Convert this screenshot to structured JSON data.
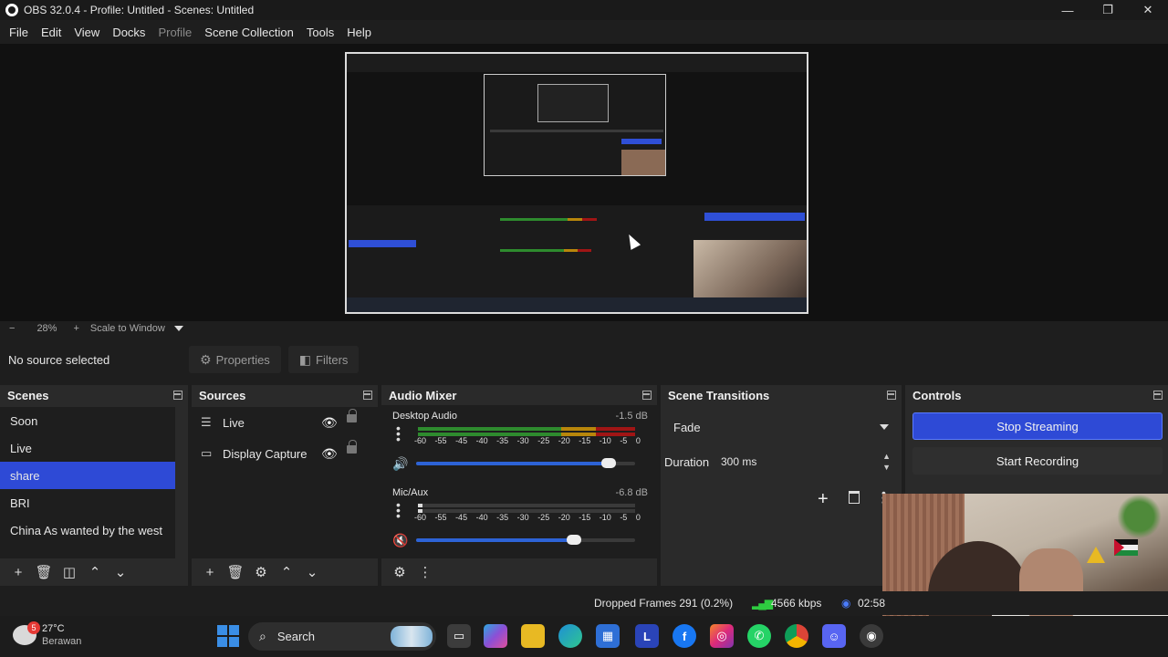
{
  "window": {
    "title": "OBS 32.0.4 - Profile: Untitled - Scenes: Untitled",
    "controls": {
      "minimize": "—",
      "restore": "❐",
      "close": "✕"
    }
  },
  "menu": {
    "file": "File",
    "edit": "Edit",
    "view": "View",
    "docks": "Docks",
    "profile": "Profile",
    "scene_collection": "Scene Collection",
    "tools": "Tools",
    "help": "Help"
  },
  "zoom": {
    "minus": "−",
    "level": "28%",
    "plus": "+",
    "mode": "Scale to Window"
  },
  "source_toolbar": {
    "status": "No source selected",
    "properties": "Properties",
    "filters": "Filters"
  },
  "scenes": {
    "title": "Scenes",
    "items": [
      {
        "label": "Soon"
      },
      {
        "label": "Live"
      },
      {
        "label": "share"
      },
      {
        "label": "BRI"
      },
      {
        "label": "China As wanted by the west"
      }
    ],
    "selected": "share"
  },
  "sources": {
    "title": "Sources",
    "items": [
      {
        "label": "Live",
        "icon": "list-icon"
      },
      {
        "label": "Display Capture",
        "icon": "monitor-icon"
      }
    ]
  },
  "audio_mixer": {
    "title": "Audio Mixer",
    "channels": [
      {
        "name": "Desktop Audio",
        "db": "-1.5 dB",
        "volume": 0.88,
        "muted": false
      },
      {
        "name": "Mic/Aux",
        "db": "-6.8 dB",
        "volume": 0.72,
        "muted": true
      }
    ],
    "ticks": [
      "-60",
      "-55",
      "-45",
      "-40",
      "-35",
      "-30",
      "-25",
      "-20",
      "-15",
      "-10",
      "-5",
      "0"
    ]
  },
  "scene_transitions": {
    "title": "Scene Transitions",
    "transition": "Fade",
    "duration_label": "Duration",
    "duration_value": "300 ms"
  },
  "controls": {
    "title": "Controls",
    "stop_streaming": "Stop Streaming",
    "start_recording": "Start Recording"
  },
  "status": {
    "dropped_frames": "Dropped Frames 291 (0.2%)",
    "bitrate": "4566 kbps",
    "time": "02:58"
  },
  "taskbar": {
    "temperature": "27°C",
    "condition": "Berawan",
    "weather_badge": "5",
    "search_label": "Search",
    "apps": [
      "file-explorer",
      "m365",
      "folder",
      "edge",
      "store",
      "l-app",
      "facebook",
      "instagram",
      "whatsapp",
      "chrome",
      "discord",
      "obs"
    ]
  },
  "colors": {
    "accent": "#2e4ad6",
    "meter_green": "#2e8b2e",
    "meter_yellow": "#b8860b",
    "meter_red": "#a01515",
    "slider": "#2d63d6"
  }
}
